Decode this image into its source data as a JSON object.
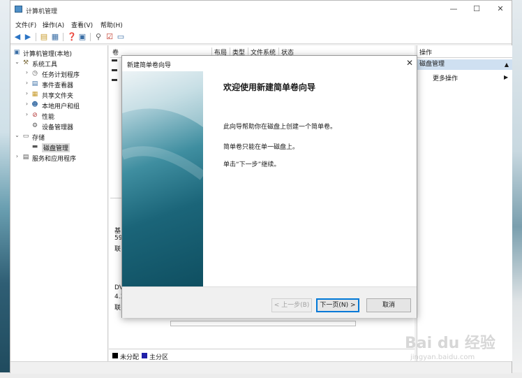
{
  "window": {
    "title": "计算机管理",
    "controls": {
      "minimize": "—",
      "maximize": "☐",
      "close": "✕"
    }
  },
  "menu": [
    "文件(F)",
    "操作(A)",
    "查看(V)",
    "帮助(H)"
  ],
  "tree": {
    "root": "计算机管理(本地)",
    "items": [
      {
        "label": "系统工具",
        "level": 1,
        "expanded": true
      },
      {
        "label": "任务计划程序",
        "level": 2
      },
      {
        "label": "事件查看器",
        "level": 2
      },
      {
        "label": "共享文件夹",
        "level": 2
      },
      {
        "label": "本地用户和组",
        "level": 2
      },
      {
        "label": "性能",
        "level": 2
      },
      {
        "label": "设备管理器",
        "level": 2
      },
      {
        "label": "存储",
        "level": 1,
        "expanded": true
      },
      {
        "label": "磁盘管理",
        "level": 2,
        "selected": true
      },
      {
        "label": "服务和应用程序",
        "level": 1
      }
    ]
  },
  "volume_columns": [
    "卷",
    "布局",
    "类型",
    "文件系统",
    "状态"
  ],
  "disk_partial": {
    "disk0": [
      "基",
      "59",
      "联"
    ],
    "dvd": [
      "DV",
      "4.3",
      "联"
    ]
  },
  "legend": [
    {
      "label": "未分配",
      "color": "#000000"
    },
    {
      "label": "主分区",
      "color": "#1f1fa8"
    }
  ],
  "actions": {
    "header": "操作",
    "section": "磁盘管理",
    "more": "更多操作"
  },
  "wizard": {
    "title": "新建简单卷向导",
    "heading": "欢迎使用新建简单卷向导",
    "lines": [
      "此向导帮助你在磁盘上创建一个简单卷。",
      "简单卷只能在单一磁盘上。",
      "单击“下一步”继续。"
    ],
    "back_label": "< 上一步(B)",
    "next_label": "下一页(N) >",
    "cancel_label": "取消"
  },
  "watermark": {
    "text": "Bai du 经验",
    "sub": "jingyan.baidu.com"
  }
}
